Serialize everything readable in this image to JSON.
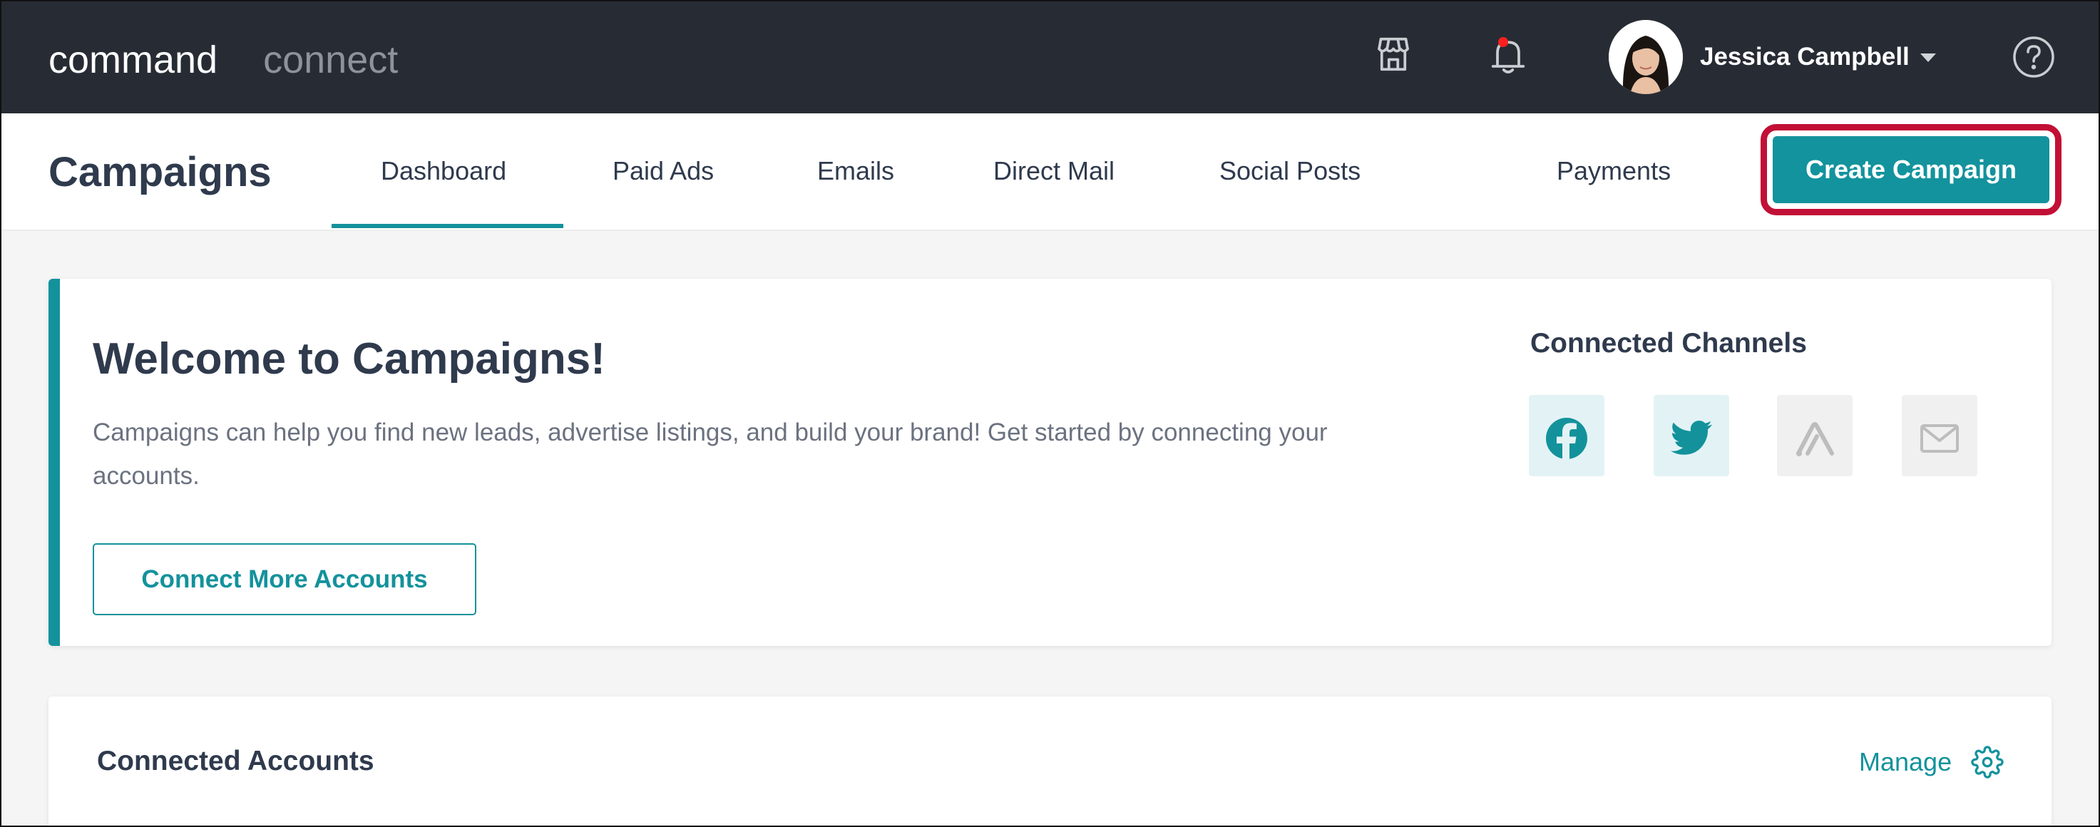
{
  "topbar": {
    "brand_primary": "command",
    "brand_secondary": "connect",
    "user_name": "Jessica Campbell"
  },
  "subnav": {
    "title": "Campaigns",
    "tabs": [
      {
        "label": "Dashboard",
        "active": true
      },
      {
        "label": "Paid Ads"
      },
      {
        "label": "Emails"
      },
      {
        "label": "Direct Mail"
      },
      {
        "label": "Social Posts"
      },
      {
        "label": "Payments"
      }
    ],
    "cta_label": "Create Campaign"
  },
  "welcome": {
    "title": "Welcome to Campaigns!",
    "description": "Campaigns can help you find new leads, advertise listings, and build your brand! Get started by connecting your accounts.",
    "connect_button": "Connect More Accounts",
    "channels_title": "Connected Channels",
    "channels": [
      {
        "icon": "facebook-icon",
        "connected": true
      },
      {
        "icon": "twitter-icon",
        "connected": true
      },
      {
        "icon": "adwords-icon",
        "connected": false
      },
      {
        "icon": "email-icon",
        "connected": false
      }
    ]
  },
  "accounts": {
    "title": "Connected Accounts",
    "manage_label": "Manage"
  },
  "colors": {
    "topbar_bg": "#272c34",
    "accent": "#13929c",
    "highlight_border": "#c20f36",
    "notification_dot": "#ff1f1f",
    "text_dark": "#2f3a4d",
    "text_muted": "#6b7280"
  }
}
